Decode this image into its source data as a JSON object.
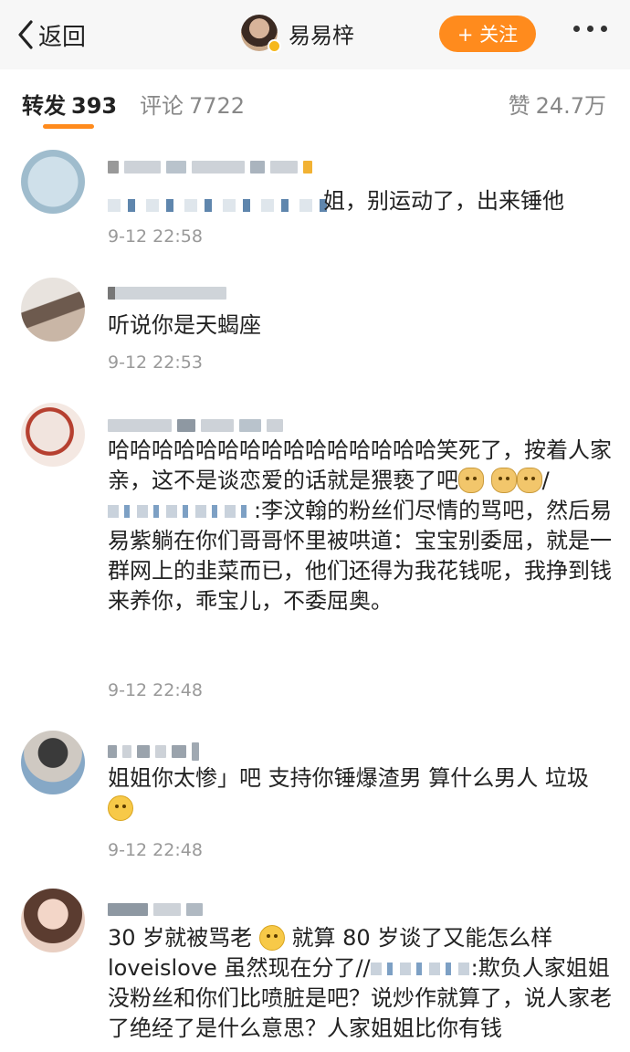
{
  "header": {
    "back_label": "返回",
    "user_name": "易易梓",
    "follow_label": "+ 关注"
  },
  "tabs": {
    "repost": {
      "label": "转发",
      "count": "393"
    },
    "comment": {
      "label": "评论",
      "count": "7722"
    },
    "like": {
      "label": "赞",
      "count": "24.7万"
    }
  },
  "comments": [
    {
      "text": "姐，别运动了，出来锤他",
      "time": "9-12 22:58"
    },
    {
      "text": "听说你是天蝎座",
      "time": "9-12 22:53"
    },
    {
      "text_part1": "哈哈哈哈哈哈哈哈哈哈哈哈哈哈哈笑死了，按着人家亲，这不是谈恋爱的话就是猥亵了吧",
      "text_part2": ":李汶翰的粉丝们尽情的骂吧，然后易易紫躺在你们哥哥怀里被哄道：宝宝别委屈，就是一群网上的韭菜而已，他们还得为我花钱呢，我挣到钱来养你，乖宝儿，不委屈奥。",
      "time": "9-12 22:48"
    },
    {
      "text": "姐姐你太惨」吧 支持你锤爆渣男 算什么男人 垃圾",
      "time": "9-12 22:48"
    },
    {
      "text_part1": "30 岁就被骂老",
      "text_part2": "就算 80 岁谈了又能怎么样 loveislove 虽然现在分了//",
      "text_part3": ":欺负人家姐姐没粉丝和你们比喷脏是吧？说炒作就算了，说人家老了绝经了是什么意思？人家姐姐比你有钱"
    }
  ]
}
